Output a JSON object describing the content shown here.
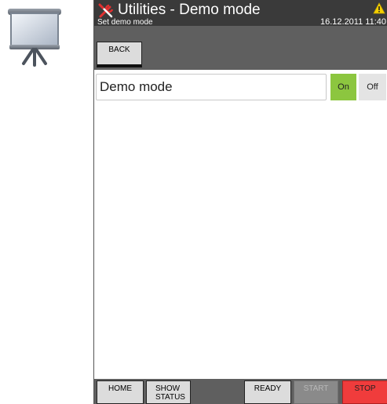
{
  "header": {
    "title": "Utilities - Demo mode",
    "subtitle": "Set demo mode",
    "datetime": "16.12.2011 11:40"
  },
  "toolbar": {
    "back_label": "BACK"
  },
  "setting": {
    "label": "Demo mode",
    "on_label": "On",
    "off_label": "Off",
    "selected": "On"
  },
  "footer": {
    "home_label": "HOME",
    "show_status_line1": "SHOW",
    "show_status_line2": "STATUS",
    "ready_label": "READY",
    "start_label": "START",
    "stop_label": "STOP"
  },
  "icons": {
    "app": "presentation-screen-icon",
    "title": "wrench-screwdriver-icon",
    "warning": "warning-triangle-icon"
  },
  "colors": {
    "on_active": "#8cc63f",
    "stop": "#f03c3c",
    "warning": "#f5d000",
    "header_bg": "#3a3a3a",
    "bar_bg": "#5f5f5f"
  }
}
